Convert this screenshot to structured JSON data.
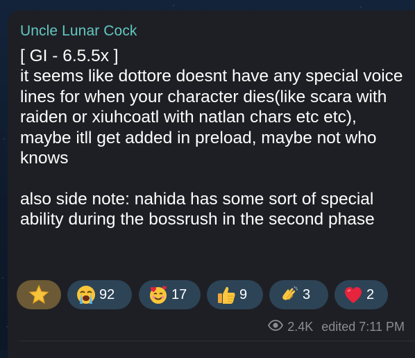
{
  "message": {
    "sender": "Uncle Lunar Cock",
    "lines": [
      "[ GI - 6.5.5x ]",
      "it seems like dottore doesnt have any special voice lines for when your character dies(like scara with raiden or xiuhcoatl with natlan chars etc etc), maybe itll get added in preload, maybe not who knows",
      "",
      "also side note: nahida has some sort of special ability during the bossrush in the second phase"
    ],
    "reactions": [
      {
        "icon": "star-emoji",
        "count": "",
        "selected": true
      },
      {
        "icon": "loudly-crying-face-emoji",
        "count": "92",
        "selected": false
      },
      {
        "icon": "smiling-face-with-hearts-emoji",
        "count": "17",
        "selected": false
      },
      {
        "icon": "thumbs-up-emoji",
        "count": "9",
        "selected": false
      },
      {
        "icon": "clapping-hands-emoji",
        "count": "3",
        "selected": false
      },
      {
        "icon": "red-heart-emoji",
        "count": "2",
        "selected": false
      }
    ],
    "views": "2.4K",
    "edited_label": "edited 7:11 PM"
  },
  "colors": {
    "sender": "#63c7c2",
    "bubble": "#1e1f24",
    "reaction_bg": "#2d4457",
    "reaction_selected_bg": "#6b5a35",
    "meta_text": "#8a8d93"
  }
}
